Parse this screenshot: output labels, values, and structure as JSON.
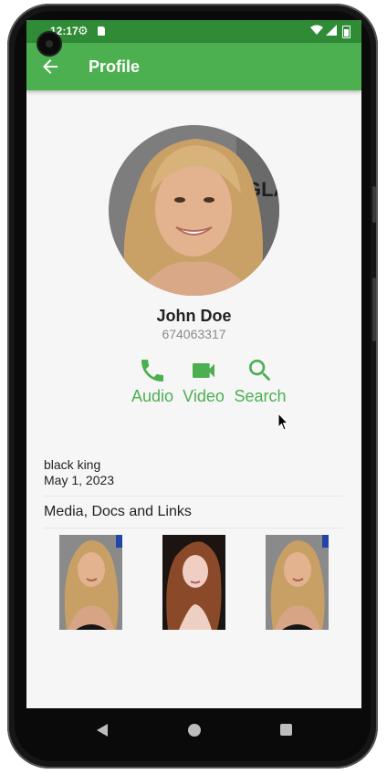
{
  "status_bar": {
    "time": "12:17",
    "icons": [
      "gear-icon",
      "sd-card-icon",
      "wifi-icon",
      "signal-icon",
      "battery-icon"
    ]
  },
  "app_bar": {
    "title": "Profile",
    "back_icon": "arrow-left-icon"
  },
  "profile": {
    "name": "John Doe",
    "phone": "674063317"
  },
  "actions": [
    {
      "label": "Audio",
      "icon": "phone-icon"
    },
    {
      "label": "Video",
      "icon": "videocam-icon"
    },
    {
      "label": "Search",
      "icon": "search-icon"
    }
  ],
  "about": {
    "status": "black king",
    "date": "May 1, 2023"
  },
  "media": {
    "title": "Media, Docs and Links",
    "items": [
      "photo-1",
      "photo-2",
      "photo-3"
    ]
  },
  "colors": {
    "primary": "#4caf50",
    "status_bar": "#2f8b35",
    "background": "#f6f6f6"
  },
  "nav": {
    "icons": [
      "back-icon",
      "home-icon",
      "recents-icon"
    ]
  }
}
